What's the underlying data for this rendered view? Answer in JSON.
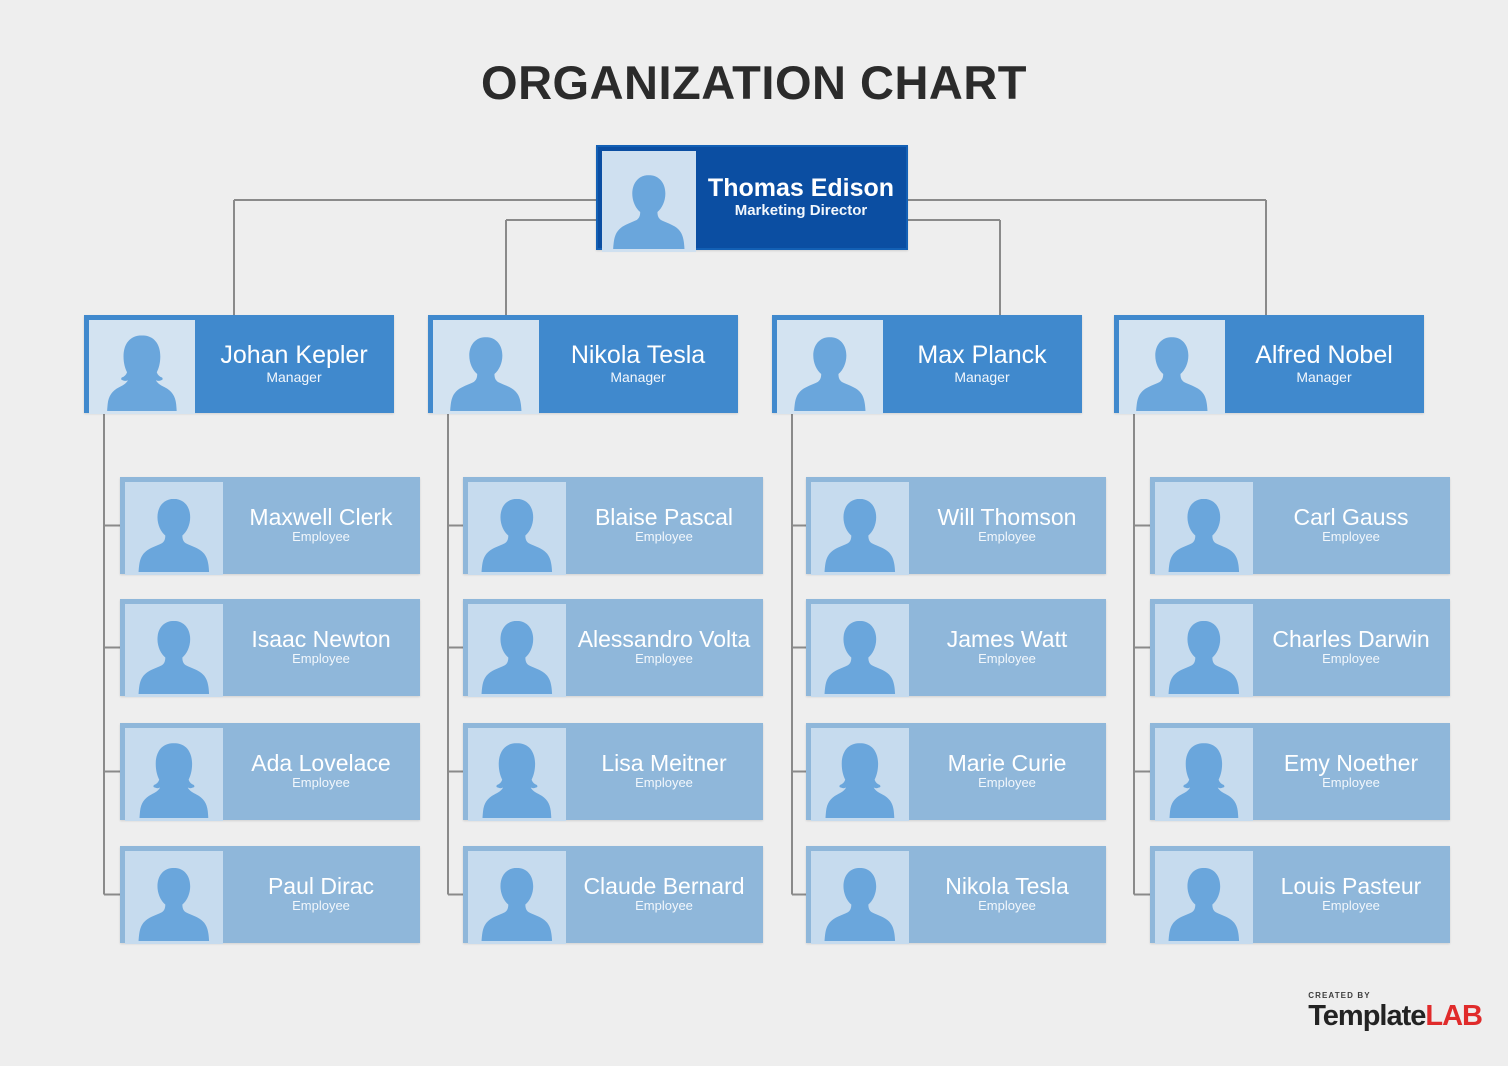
{
  "title": "ORGANIZATION CHART",
  "colors": {
    "background": "#eeeeee",
    "root_box": "#0b4ea2",
    "manager_box": "#4089cd",
    "employee_box": "#8fb7da",
    "connector_line": "#8a8a8a",
    "title_text": "#2b2b2b",
    "logo_accent": "#e02b2b"
  },
  "root": {
    "name": "Thomas Edison",
    "role": "Marketing Director",
    "avatar": "person-avatar-male-icon"
  },
  "branches": [
    {
      "manager": {
        "name": "Johan Kepler",
        "role": "Manager",
        "avatar": "person-avatar-female-icon"
      },
      "employees": [
        {
          "name": "Maxwell Clerk",
          "role": "Employee",
          "avatar": "person-avatar-male-icon"
        },
        {
          "name": "Isaac Newton",
          "role": "Employee",
          "avatar": "person-avatar-male-icon"
        },
        {
          "name": "Ada Lovelace",
          "role": "Employee",
          "avatar": "person-avatar-female-icon"
        },
        {
          "name": "Paul Dirac",
          "role": "Employee",
          "avatar": "person-avatar-male-icon"
        }
      ]
    },
    {
      "manager": {
        "name": "Nikola Tesla",
        "role": "Manager",
        "avatar": "person-avatar-male-icon"
      },
      "employees": [
        {
          "name": "Blaise Pascal",
          "role": "Employee",
          "avatar": "person-avatar-male-icon"
        },
        {
          "name": "Alessandro Volta",
          "role": "Employee",
          "avatar": "person-avatar-male-icon"
        },
        {
          "name": "Lisa Meitner",
          "role": "Employee",
          "avatar": "person-avatar-female-icon"
        },
        {
          "name": "Claude Bernard",
          "role": "Employee",
          "avatar": "person-avatar-male-icon"
        }
      ]
    },
    {
      "manager": {
        "name": "Max Planck",
        "role": "Manager",
        "avatar": "person-avatar-male-icon"
      },
      "employees": [
        {
          "name": "Will Thomson",
          "role": "Employee",
          "avatar": "person-avatar-male-icon"
        },
        {
          "name": "James Watt",
          "role": "Employee",
          "avatar": "person-avatar-male-icon"
        },
        {
          "name": "Marie Curie",
          "role": "Employee",
          "avatar": "person-avatar-female-icon"
        },
        {
          "name": "Nikola Tesla",
          "role": "Employee",
          "avatar": "person-avatar-male-icon"
        }
      ]
    },
    {
      "manager": {
        "name": "Alfred Nobel",
        "role": "Manager",
        "avatar": "person-avatar-male-icon"
      },
      "employees": [
        {
          "name": "Carl Gauss",
          "role": "Employee",
          "avatar": "person-avatar-male-icon"
        },
        {
          "name": "Charles Darwin",
          "role": "Employee",
          "avatar": "person-avatar-male-icon"
        },
        {
          "name": "Emy Noether",
          "role": "Employee",
          "avatar": "person-avatar-female-icon"
        },
        {
          "name": "Louis Pasteur",
          "role": "Employee",
          "avatar": "person-avatar-male-icon"
        }
      ]
    }
  ],
  "logo": {
    "created_by": "CREATED BY",
    "brand_primary": "Template",
    "brand_accent": "LAB"
  }
}
